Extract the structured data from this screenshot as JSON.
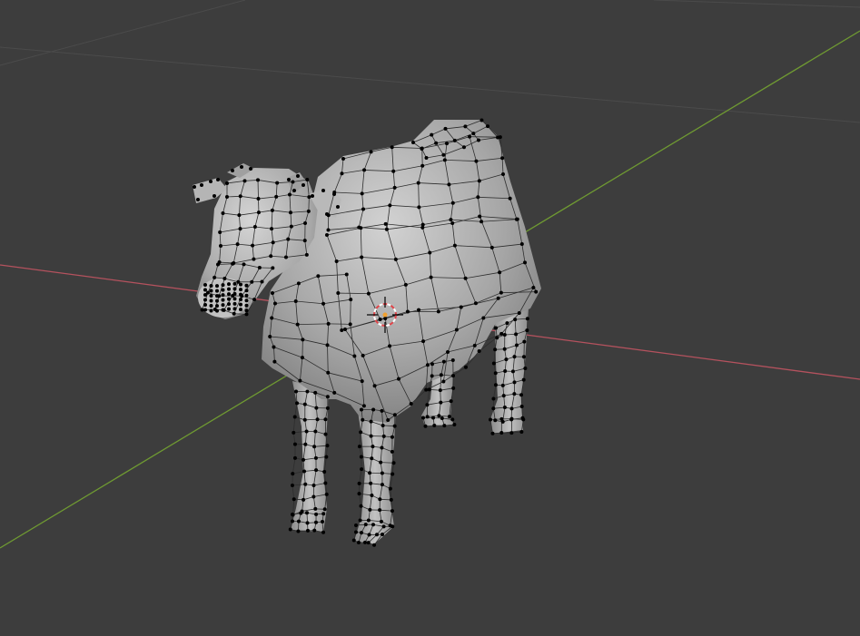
{
  "viewport": {
    "mode": "edit-mode",
    "overlays": {
      "grid": true,
      "x_axis": true,
      "y_axis": true,
      "wireframe": true,
      "vertices": true
    },
    "colors": {
      "background": "#3d3d3d",
      "grid_line": "#4a4a4a",
      "x_axis": "#b5525e",
      "y_axis": "#6f9a32",
      "mesh_fill": "#9d9d9d",
      "mesh_light": "#c8c8c8",
      "mesh_shadow": "#7a7a7a",
      "wire": "#2a2a2a",
      "vertex": "#000000",
      "cursor_red": "#e0454a",
      "cursor_white": "#ffffff",
      "origin": "#f0a030"
    }
  },
  "scene": {
    "object_name": "cow-mesh",
    "cursor_icon": "3d-cursor-icon"
  }
}
